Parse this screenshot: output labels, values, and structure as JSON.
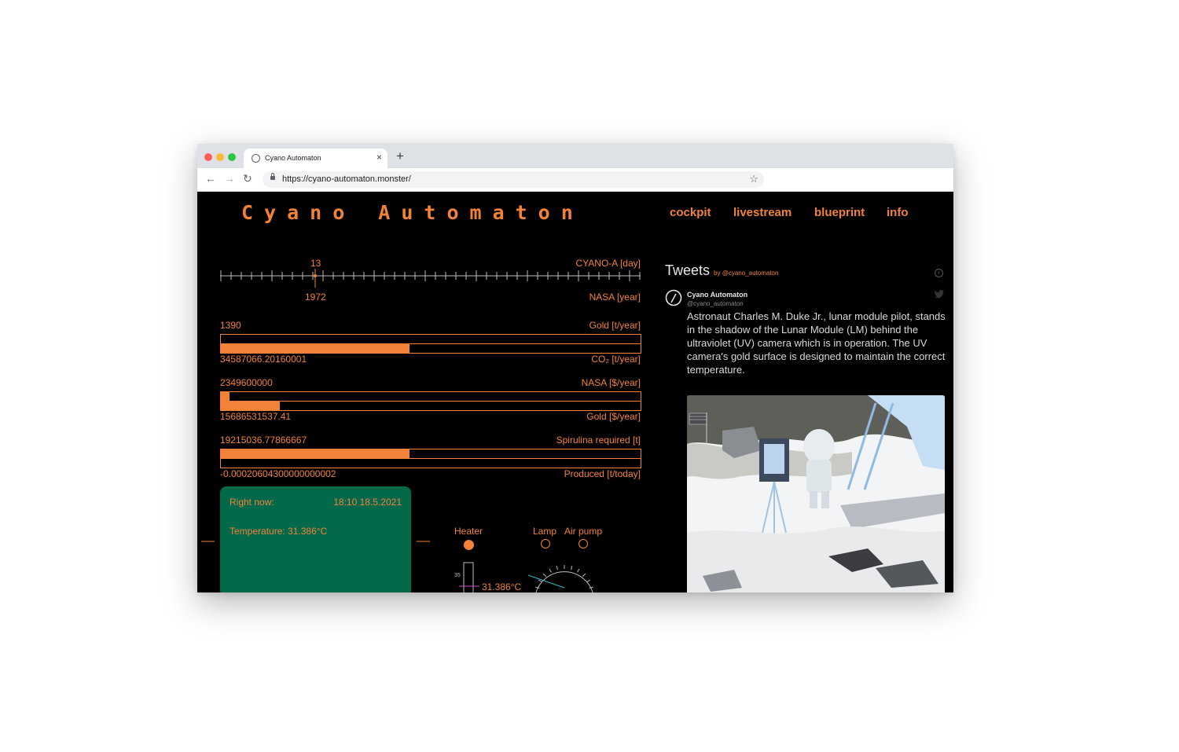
{
  "browser": {
    "tab_title": "Cyano Automaton",
    "tab_close": "×",
    "new_tab": "+",
    "url": "https://cyano-automaton.monster/",
    "back": "←",
    "forward": "→",
    "reload": "↻",
    "star": "☆",
    "traffic_colors": [
      "#ff5f57",
      "#febc2e",
      "#28c840"
    ]
  },
  "site": {
    "logo": "Cyano Automaton",
    "nav": [
      "cockpit",
      "livestream",
      "blueprint",
      "info"
    ],
    "accent_color": "#f28238"
  },
  "timeline": {
    "day_value": "13",
    "day_label": "CYANO-A [day]",
    "year_value": "1972",
    "year_label": "NASA [year]"
  },
  "bars": [
    {
      "top_value": "1390",
      "top_label": "Gold [t/year]",
      "bottom_value": "34587066.20160001",
      "bottom_label": "CO₂ [t/year]",
      "fill_top": 0.0,
      "fill_bottom": 0.45
    },
    {
      "top_value": "2349600000",
      "top_label": "NASA [$/year]",
      "bottom_value": "15686531537.41",
      "bottom_label": "Gold [$/year]",
      "fill_top": 0.02,
      "fill_bottom": 0.14
    },
    {
      "top_value": "19215036.77866667",
      "top_label": "Spirulina required [t]",
      "bottom_value": "-0.00020604300000000002",
      "bottom_label": "Produced [t/today]",
      "fill_top": 0.45,
      "fill_bottom": 0.0
    }
  ],
  "status": {
    "right_now_label": "Right now:",
    "timestamp": "18:10 18.5.2021",
    "temperature": "Temperature: 31.386°C",
    "panel_color": "#04684a"
  },
  "controls": {
    "heater": "Heater",
    "lamp": "Lamp",
    "air_pump": "Air pump",
    "thermo_tick": "35",
    "thermo_value": "31.386°C"
  },
  "twitter": {
    "heading": "Tweets",
    "by": "by @cyano_automaton",
    "name": "Cyano Automaton",
    "handle": "@cyano_automaton",
    "text": "Astronaut Charles M. Duke Jr., lunar module pilot, stands in the shadow of the Lunar Module (LM) behind the ultraviolet (UV) camera which is in operation. The UV camera's gold surface is designed to maintain the correct temperature."
  }
}
